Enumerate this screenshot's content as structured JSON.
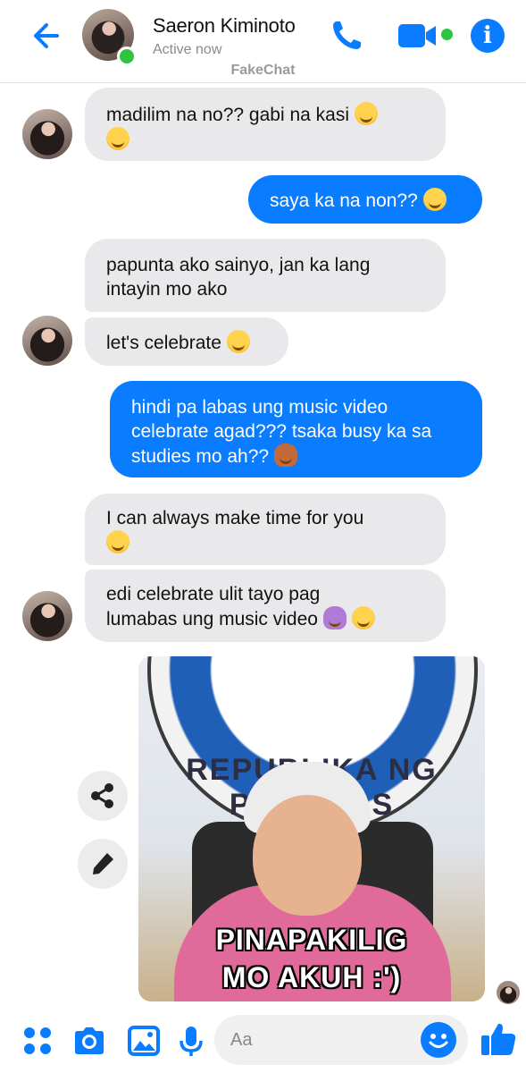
{
  "header": {
    "contact_name": "Saeron Kiminoto",
    "status": "Active now",
    "app_label": "FakeChat"
  },
  "messages": [
    {
      "from": "them",
      "line1": "madilim na no?? gabi na kasi",
      "line2": ""
    },
    {
      "from": "me",
      "line1": "saya ka na non??",
      "line2": ""
    },
    {
      "from": "them",
      "line1": "papunta ako sainyo, jan ka lang",
      "line2": "intayin mo ako"
    },
    {
      "from": "them",
      "line1": "let's celebrate",
      "line2": ""
    },
    {
      "from": "me",
      "line1": "hindi pa labas ung music video",
      "line2": "celebrate agad??? tsaka busy ka sa",
      "line3": "studies mo ah??"
    },
    {
      "from": "them",
      "line1": "I can always make time for you",
      "line2": ""
    },
    {
      "from": "them",
      "line1": "edi celebrate ulit tayo pag",
      "line2": "lumabas ung music video"
    }
  ],
  "sticker": {
    "seal_text": "REPUBLIKA NG PILIPINAS",
    "caption_line1": "PINAPAKILIG",
    "caption_line2": "MO AKUH :')"
  },
  "composer": {
    "placeholder": "Aa"
  },
  "colors": {
    "accent": "#0a7cff",
    "incoming_bubble": "#e9e9eb",
    "online": "#2fc43b"
  },
  "icons": [
    "back-arrow-icon",
    "phone-icon",
    "video-camera-icon",
    "info-icon",
    "share-icon",
    "pencil-icon",
    "apps-icon",
    "camera-icon",
    "image-icon",
    "microphone-icon",
    "emoji-icon",
    "thumbs-up-icon"
  ]
}
